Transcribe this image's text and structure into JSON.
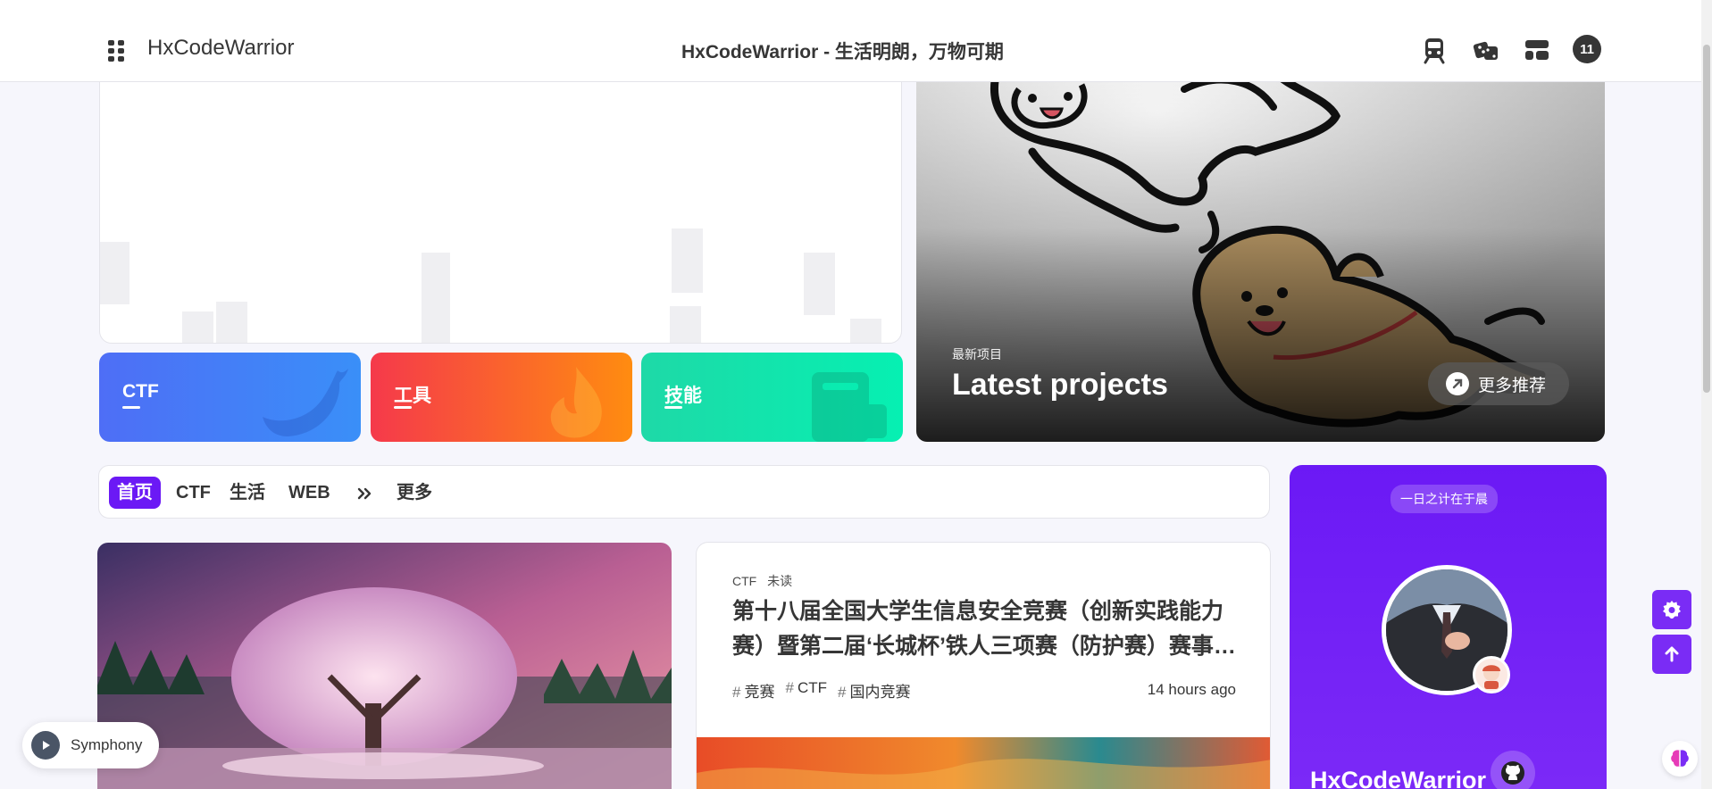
{
  "header": {
    "brand": "HxCodeWarrior",
    "center_title": "HxCodeWarrior - 生活明朗，万物可期",
    "nav_icons": [
      "train-icon",
      "dice-icon",
      "layout-icon"
    ],
    "badge_count": "11"
  },
  "categories": [
    {
      "label": "CTF",
      "icon": "twitter-icon",
      "colors": [
        "#4e6ef6",
        "#3a8ff8"
      ]
    },
    {
      "label": "工具",
      "icon": "fire-icon",
      "colors": [
        "#f5394b",
        "#ff8c10"
      ]
    },
    {
      "label": "技能",
      "icon": "book-icon",
      "colors": [
        "#1ed9a7",
        "#06f0b2"
      ]
    }
  ],
  "projects": {
    "subtitle": "最新项目",
    "title": "Latest projects",
    "more_label": "更多推荐"
  },
  "tabs": [
    {
      "label": "首页",
      "active": true
    },
    {
      "label": "CTF",
      "active": false
    },
    {
      "label": "生活",
      "active": false
    },
    {
      "label": "WEB",
      "active": false
    },
    {
      "label": "更多",
      "active": false
    }
  ],
  "post": {
    "category": "CTF",
    "status": "未读",
    "title": "第十八届全国大学生信息安全竞赛（创新实践能力赛）暨第二届‘长城杯’铁人三项赛（防护赛）赛事WP",
    "tags": [
      "竞赛",
      "CTF",
      "国内竞赛"
    ],
    "time": "14 hours ago"
  },
  "profile": {
    "motto": "一日之计在于晨",
    "name": "HxCodeWarrior"
  },
  "music": {
    "song": "Symphony"
  },
  "colors": {
    "accent": "#6b19f5",
    "background": "#f6f6fc"
  }
}
